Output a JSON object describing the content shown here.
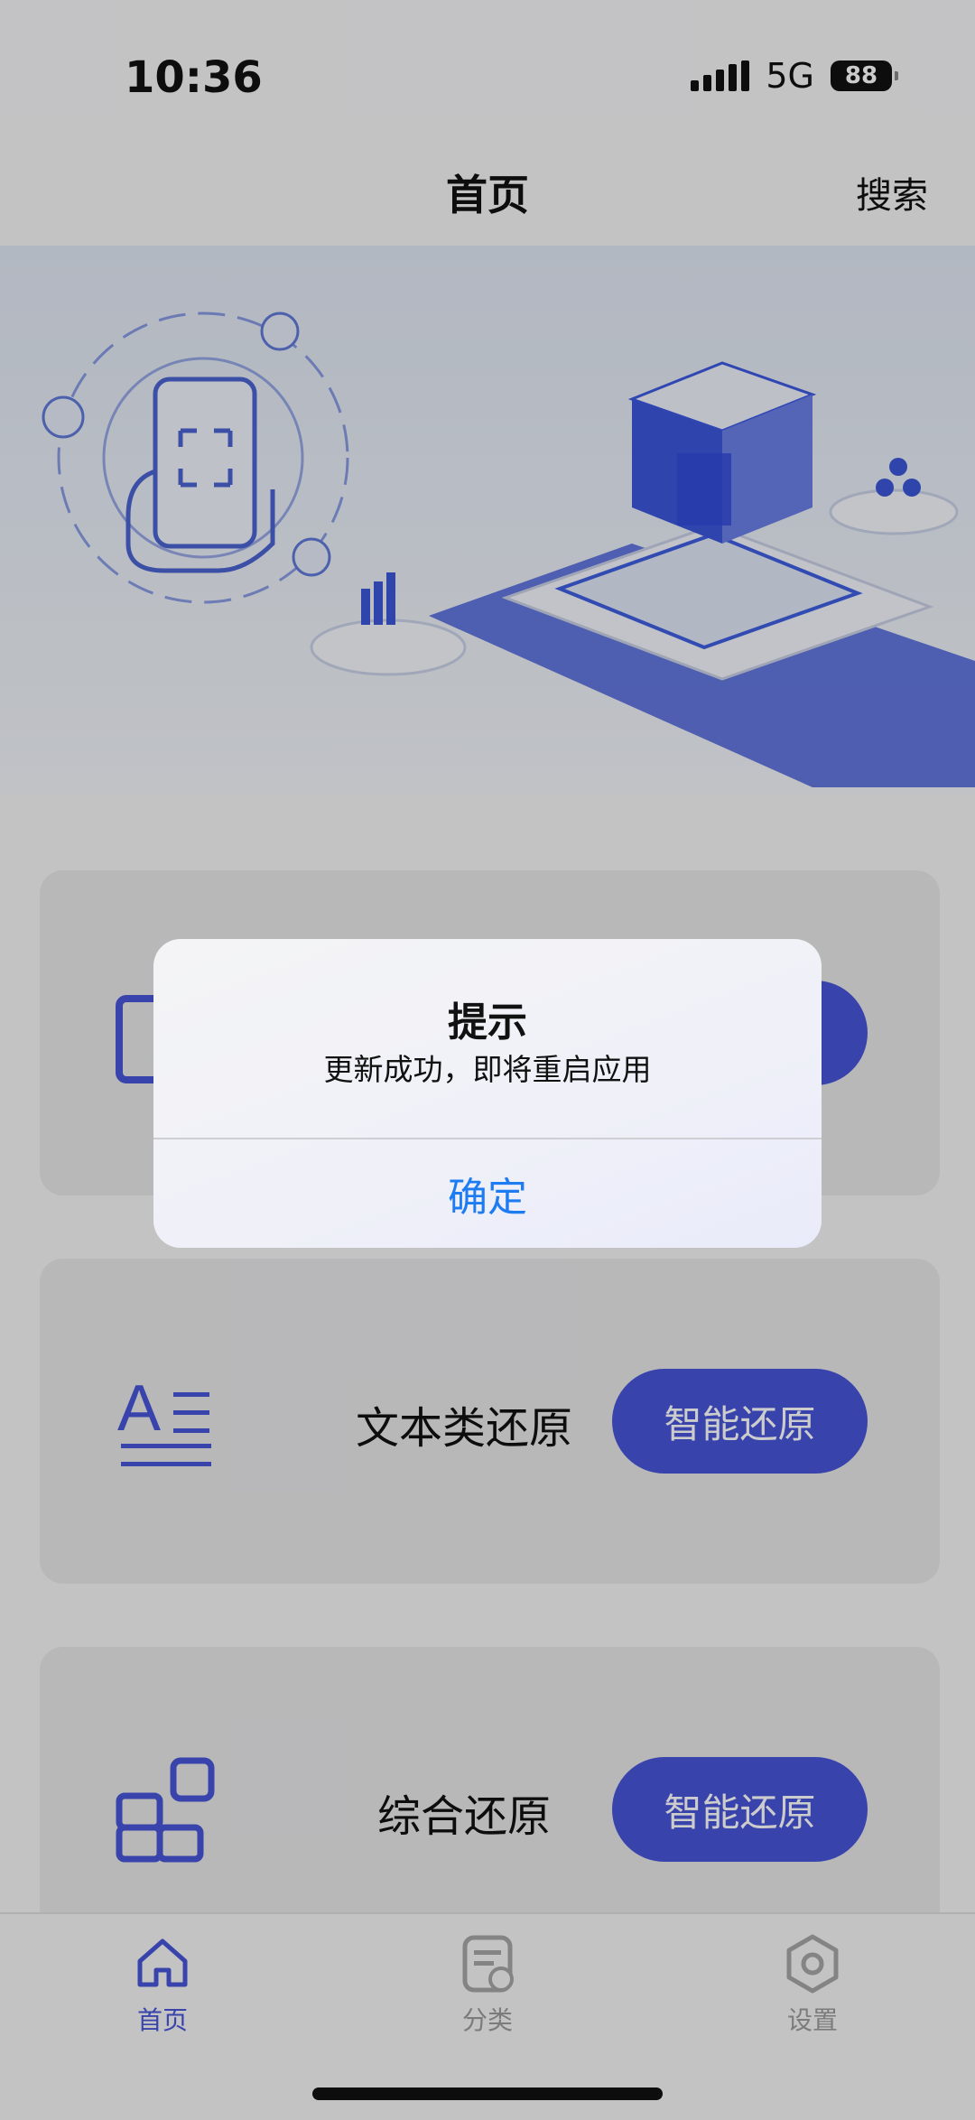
{
  "status_bar": {
    "time": "10:36",
    "network": "5G",
    "battery": "88"
  },
  "nav": {
    "title": "首页",
    "search_label": "搜索"
  },
  "cards": [
    {
      "label": "",
      "button": "",
      "icon": "photo-frame-icon"
    },
    {
      "label": "文本类还原",
      "button": "智能还原",
      "icon": "text-lines-icon"
    },
    {
      "label": "综合还原",
      "button": "智能还原",
      "icon": "grid-blocks-icon"
    }
  ],
  "tabs": [
    {
      "label": "首页",
      "icon": "home-icon",
      "active": true
    },
    {
      "label": "分类",
      "icon": "document-clock-icon",
      "active": false
    },
    {
      "label": "设置",
      "icon": "hexagon-settings-icon",
      "active": false
    }
  ],
  "dialog": {
    "title": "提示",
    "message": "更新成功，即将重启应用",
    "confirm_label": "确定"
  },
  "colors": {
    "accent": "#4754d8",
    "dialog_button": "#1e7cf2",
    "overlay": "rgba(0,0,0,0.2)"
  }
}
